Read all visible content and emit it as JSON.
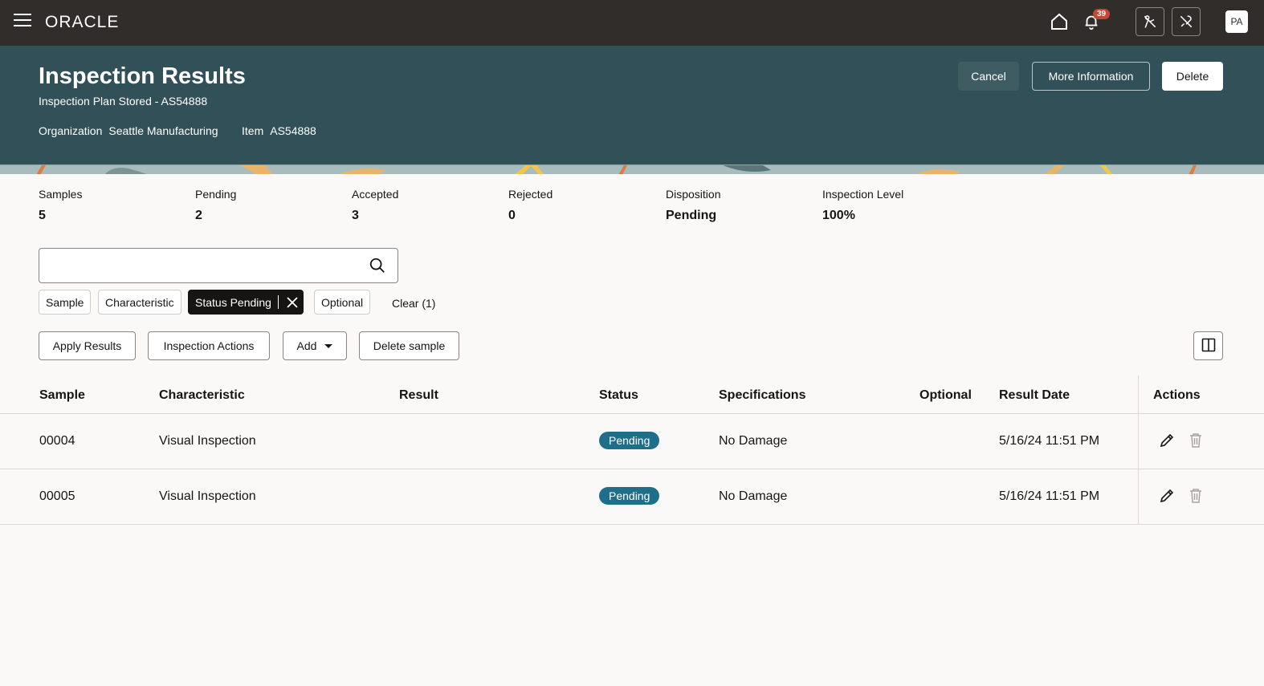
{
  "topbar": {
    "logo": "ORACLE",
    "notification_count": "39",
    "avatar_initials": "PA"
  },
  "header": {
    "title": "Inspection Results",
    "subtitle": "Inspection Plan Stored - AS54888",
    "organization_label": "Organization",
    "organization_value": "Seattle Manufacturing",
    "item_label": "Item",
    "item_value": "AS54888",
    "cancel_label": "Cancel",
    "more_info_label": "More Information",
    "delete_label": "Delete"
  },
  "summary": [
    {
      "label": "Samples",
      "value": "5"
    },
    {
      "label": "Pending",
      "value": "2"
    },
    {
      "label": "Accepted",
      "value": "3"
    },
    {
      "label": "Rejected",
      "value": "0"
    },
    {
      "label": "Disposition",
      "value": "Pending"
    },
    {
      "label": "Inspection Level",
      "value": "100%"
    }
  ],
  "search": {
    "placeholder": ""
  },
  "filters": {
    "chips": [
      "Sample",
      "Characteristic",
      "Status Pending",
      "Optional"
    ],
    "clear_label": "Clear (1)"
  },
  "toolbar": {
    "apply_results": "Apply Results",
    "inspection_actions": "Inspection Actions",
    "add": "Add",
    "delete_sample": "Delete sample"
  },
  "table": {
    "columns": [
      "Sample",
      "Characteristic",
      "Result",
      "Status",
      "Specifications",
      "Optional",
      "Result Date",
      "Actions"
    ],
    "rows": [
      {
        "sample": "00004",
        "characteristic": "Visual Inspection",
        "result": "",
        "status": "Pending",
        "specifications": "No Damage",
        "optional": "",
        "result_date": "5/16/24 11:51 PM"
      },
      {
        "sample": "00005",
        "characteristic": "Visual Inspection",
        "result": "",
        "status": "Pending",
        "specifications": "No Damage",
        "optional": "",
        "result_date": "5/16/24 11:51 PM"
      }
    ]
  },
  "colors": {
    "topbar": "#312d2a",
    "header": "#325057",
    "status_pending": "#1f6f8b"
  }
}
